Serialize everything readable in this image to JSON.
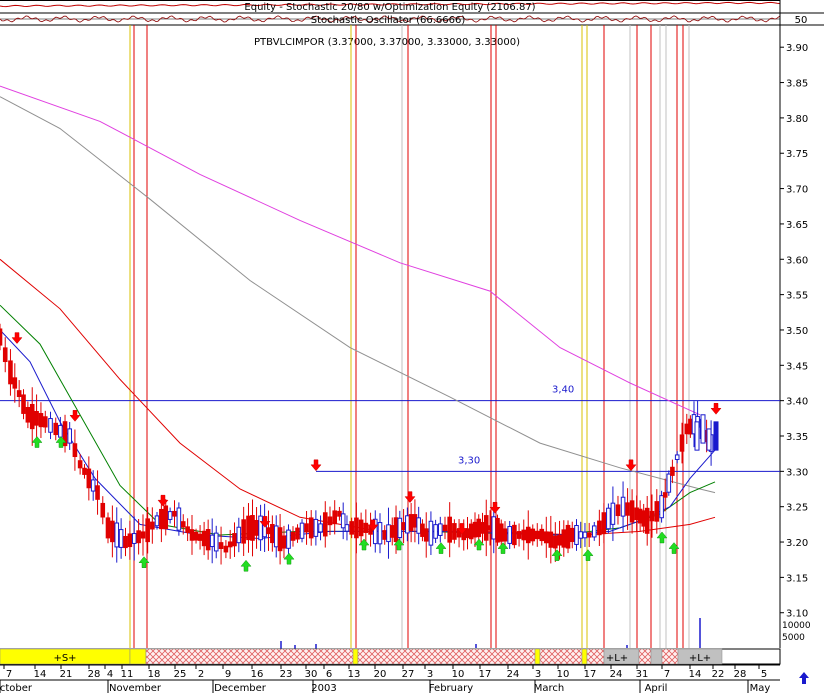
{
  "header": {
    "equity_title": "Equity - Stochastic 20/80 w/Optimization Equity (2106.87)",
    "oscillator_title": "Stochastic Oscillator (66.6666)",
    "oscillator_value": "50",
    "price_title": "PTBVLCIMPOR (3.37000, 3.37000, 3.33000, 3.33000)"
  },
  "chart_data": {
    "type": "candlestick",
    "title": "PTBVLCIMPOR (3.37000, 3.37000, 3.33000, 3.33000)",
    "ylim": [
      3.06,
      3.93
    ],
    "y_ticks": [
      3.1,
      3.15,
      3.2,
      3.25,
      3.3,
      3.35,
      3.4,
      3.45,
      3.5,
      3.55,
      3.6,
      3.65,
      3.7,
      3.75,
      3.8,
      3.85,
      3.9
    ],
    "volume_ticks": [
      "10000",
      "5000"
    ],
    "x_day_labels": [
      "7",
      "14",
      "21",
      "28",
      "4",
      "11",
      "18",
      "25",
      "2",
      "9",
      "16",
      "23",
      "30",
      "6",
      "13",
      "20",
      "27",
      "3",
      "10",
      "17",
      "24",
      "3",
      "10",
      "17",
      "24",
      "31",
      "7",
      "14",
      "22",
      "28",
      "5"
    ],
    "x_month_labels": [
      "October",
      "November",
      "December",
      "2003",
      "February",
      "March",
      "April",
      "May"
    ],
    "horizontal_lines": [
      {
        "label": "3,40",
        "value": 3.4
      },
      {
        "label": "3,30",
        "value": 3.3
      }
    ],
    "position_labels": [
      "+S+",
      "+L+",
      "+L+"
    ],
    "close_by_date": [
      [
        "2002-10-01",
        3.49
      ],
      [
        "2002-10-04",
        3.44
      ],
      [
        "2002-10-09",
        3.38
      ],
      [
        "2002-10-14",
        3.37
      ],
      [
        "2002-10-17",
        3.36
      ],
      [
        "2002-10-21",
        3.35
      ],
      [
        "2002-10-24",
        3.31
      ],
      [
        "2002-10-29",
        3.27
      ],
      [
        "2002-11-01",
        3.22
      ],
      [
        "2002-11-06",
        3.2
      ],
      [
        "2002-11-11",
        3.21
      ],
      [
        "2002-11-15",
        3.23
      ],
      [
        "2002-11-20",
        3.24
      ],
      [
        "2002-11-25",
        3.21
      ],
      [
        "2002-12-02",
        3.2
      ],
      [
        "2002-12-05",
        3.19
      ],
      [
        "2002-12-09",
        3.21
      ],
      [
        "2002-12-12",
        3.22
      ],
      [
        "2002-12-17",
        3.22
      ],
      [
        "2002-12-23",
        3.2
      ],
      [
        "2002-12-30",
        3.22
      ],
      [
        "2003-01-03",
        3.22
      ],
      [
        "2003-01-08",
        3.24
      ],
      [
        "2003-01-10",
        3.22
      ],
      [
        "2003-01-15",
        3.22
      ],
      [
        "2003-01-20",
        3.21
      ],
      [
        "2003-01-24",
        3.22
      ],
      [
        "2003-01-28",
        3.23
      ],
      [
        "2003-01-31",
        3.21
      ],
      [
        "2003-02-05",
        3.22
      ],
      [
        "2003-02-10",
        3.21
      ],
      [
        "2003-02-14",
        3.22
      ],
      [
        "2003-02-18",
        3.22
      ],
      [
        "2003-02-21",
        3.21
      ],
      [
        "2003-02-26",
        3.21
      ],
      [
        "2003-03-03",
        3.21
      ],
      [
        "2003-03-07",
        3.2
      ],
      [
        "2003-03-12",
        3.21
      ],
      [
        "2003-03-17",
        3.21
      ],
      [
        "2003-03-20",
        3.22
      ],
      [
        "2003-03-24",
        3.24
      ],
      [
        "2003-03-27",
        3.25
      ],
      [
        "2003-03-31",
        3.24
      ],
      [
        "2003-04-03",
        3.23
      ],
      [
        "2003-04-07",
        3.25
      ],
      [
        "2003-04-10",
        3.3
      ],
      [
        "2003-04-14",
        3.36
      ],
      [
        "2003-04-17",
        3.37
      ],
      [
        "2003-04-22",
        3.33
      ]
    ]
  }
}
